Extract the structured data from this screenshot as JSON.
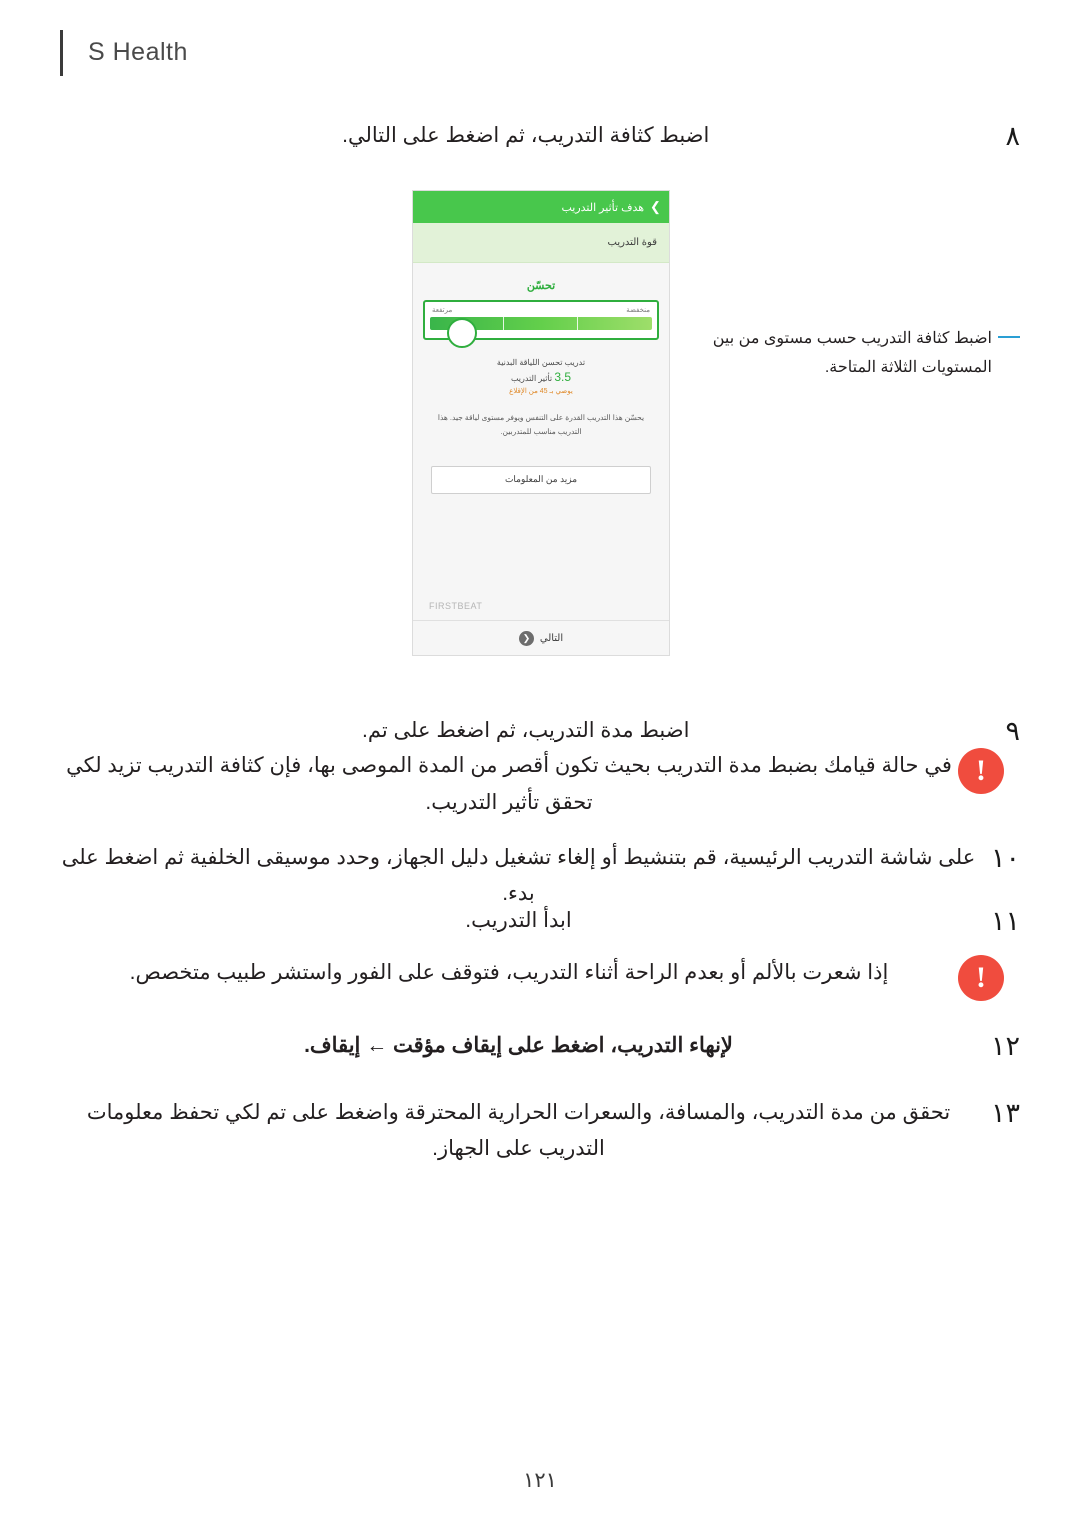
{
  "header": {
    "title": "S Health"
  },
  "steps": [
    {
      "num": "٨",
      "text": "اضبط كثافة التدريب، ثم اضغط على التالي."
    },
    {
      "num": "٩",
      "text": "اضبط مدة التدريب، ثم اضغط على تم."
    },
    {
      "num": "١٠",
      "text": "على شاشة التدريب الرئيسية، قم بتنشيط أو إلغاء تشغيل دليل الجهاز، وحدد موسيقى الخلفية ثم اضغط على بدء."
    },
    {
      "num": "١١",
      "text": "ابدأ التدريب."
    },
    {
      "num": "١٢",
      "text": "لإنهاء التدريب، اضغط على إيقاف مؤقت ← إيقاف.",
      "bold_tail": true
    },
    {
      "num": "١٣",
      "text": "تحقق من مدة التدريب، والمسافة، والسعرات الحرارية المحترقة واضغط على تم لكي تحفظ معلومات التدريب على الجهاز."
    }
  ],
  "notes": [
    {
      "icon": "!",
      "text": "في حالة قيامك بضبط مدة التدريب بحيث تكون أقصر من المدة الموصى بها، فإن كثافة التدريب تزيد لكي تحقق تأثير التدريب."
    },
    {
      "icon": "!",
      "text": "إذا شعرت بالألم أو بعدم الراحة أثناء التدريب، فتوقف على الفور واستشر طبيب متخصص."
    }
  ],
  "callout": {
    "text": "اضبط كثافة التدريب حسب مستوى من بين المستويات الثلاثة المتاحة."
  },
  "phone": {
    "topbar_title": "هدف تأثير التدريب",
    "back_icon": "chevron-right-icon",
    "subbar_label": "قوة التدريب",
    "green_title": "تحسّن",
    "bar_label_right": "مرتفعة",
    "bar_label_left": "منخفضة",
    "caption": "تدريب تحسن اللياقة البدنية",
    "caption_value": "3.5",
    "caption_value_label": "تأثير التدريب",
    "caption_sub": "يوصي بـ 45 من الإقلاع",
    "paragraph": "يحسّن هذا التدريب القدرة على التنفس ويوفر مستوى لياقة جيد. هذا التدريب مناسب للمتدربين.",
    "more_button": "مزيد من المعلومات",
    "brand": "FIRSTBEAT",
    "next_label": "التالي",
    "next_icon": "arrow-right-icon"
  },
  "page_number": "١٢١",
  "colors": {
    "accent_green": "#2fae3e",
    "topbar_green": "#48c74c",
    "warning_red": "#f04c3e",
    "callout_blue": "#2a9fd4"
  }
}
